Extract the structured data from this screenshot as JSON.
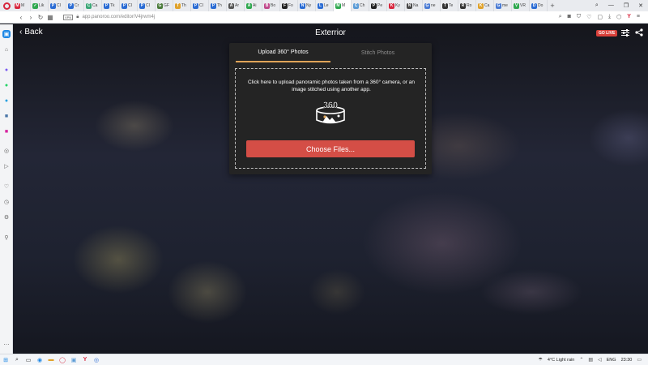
{
  "browser": {
    "tabs": [
      {
        "label": "M",
        "color": "#d7263d",
        "glyph": "M"
      },
      {
        "label": "Lik",
        "color": "#2fa84f",
        "glyph": "✓"
      },
      {
        "label": "CI",
        "color": "#2b6cd4",
        "glyph": "P"
      },
      {
        "label": "Cr",
        "color": "#2b6cd4",
        "glyph": "P"
      },
      {
        "label": "Ca",
        "color": "#3aa776",
        "glyph": "C"
      },
      {
        "label": "Tk",
        "color": "#2b6cd4",
        "glyph": "P"
      },
      {
        "label": "CI",
        "color": "#2b6cd4",
        "glyph": "P"
      },
      {
        "label": "CI",
        "color": "#2b6cd4",
        "glyph": "P"
      },
      {
        "label": "GF",
        "color": "#4a7b3a",
        "glyph": "G"
      },
      {
        "label": "Th",
        "color": "#e0a22b",
        "glyph": "T"
      },
      {
        "label": "CI",
        "color": "#2b6cd4",
        "glyph": "P"
      },
      {
        "label": "Th",
        "color": "#2b6cd4",
        "glyph": "P"
      },
      {
        "label": "Ar",
        "color": "#555555",
        "glyph": "A"
      },
      {
        "label": "Ai",
        "color": "#2fa84f",
        "glyph": "A"
      },
      {
        "label": "Bo",
        "color": "#c04a8c",
        "glyph": "B"
      },
      {
        "label": "Fo",
        "color": "#222222",
        "glyph": "F"
      },
      {
        "label": "Ny",
        "color": "#2b6cd4",
        "glyph": "N"
      },
      {
        "label": "Le",
        "color": "#2b6cd4",
        "glyph": "L"
      },
      {
        "label": "M",
        "color": "#2fa84f",
        "glyph": "M",
        "active": true
      },
      {
        "label": "Ch",
        "color": "#5a9bd6",
        "glyph": "C"
      },
      {
        "label": "Pe",
        "color": "#222222",
        "glyph": "P"
      },
      {
        "label": "Ky",
        "color": "#d7263d",
        "glyph": "K"
      },
      {
        "label": "Na",
        "color": "#4a4a4a",
        "glyph": "N"
      },
      {
        "label": "ne",
        "color": "#4a7bd4",
        "glyph": "G"
      },
      {
        "label": "Te",
        "color": "#333333",
        "glyph": "T"
      },
      {
        "label": "Ro",
        "color": "#333333",
        "glyph": "R"
      },
      {
        "label": "Ca",
        "color": "#e0a22b",
        "glyph": "K"
      },
      {
        "label": "me",
        "color": "#4a7bd4",
        "glyph": "G"
      },
      {
        "label": "VR",
        "color": "#2fa84f",
        "glyph": "V"
      },
      {
        "label": "Do",
        "color": "#2b6cd4",
        "glyph": "D"
      }
    ],
    "new_tab": "+",
    "vpn_badge": "VPN",
    "url": "app.panoroo.com/editor/V4jrwm4j"
  },
  "app": {
    "back_label": "Back",
    "title": "Exterrior",
    "go_live_label": "GO LIVE"
  },
  "upload": {
    "tab_upload_label": "Upload 360° Photos",
    "tab_stitch_label": "Stitch Photos",
    "instruction": "Click here to upload panoramic photos taken from a 360° camera, or an image stitched using another app.",
    "icon_text": "360",
    "button_label": "Choose Files..."
  },
  "taskbar": {
    "weather": "4°C  Light rain",
    "language": "ENG",
    "time": "23:30"
  },
  "colors": {
    "accent_tab_underline": "#e0a458",
    "button_red": "#d44e46",
    "go_live_red": "#d8403a"
  }
}
